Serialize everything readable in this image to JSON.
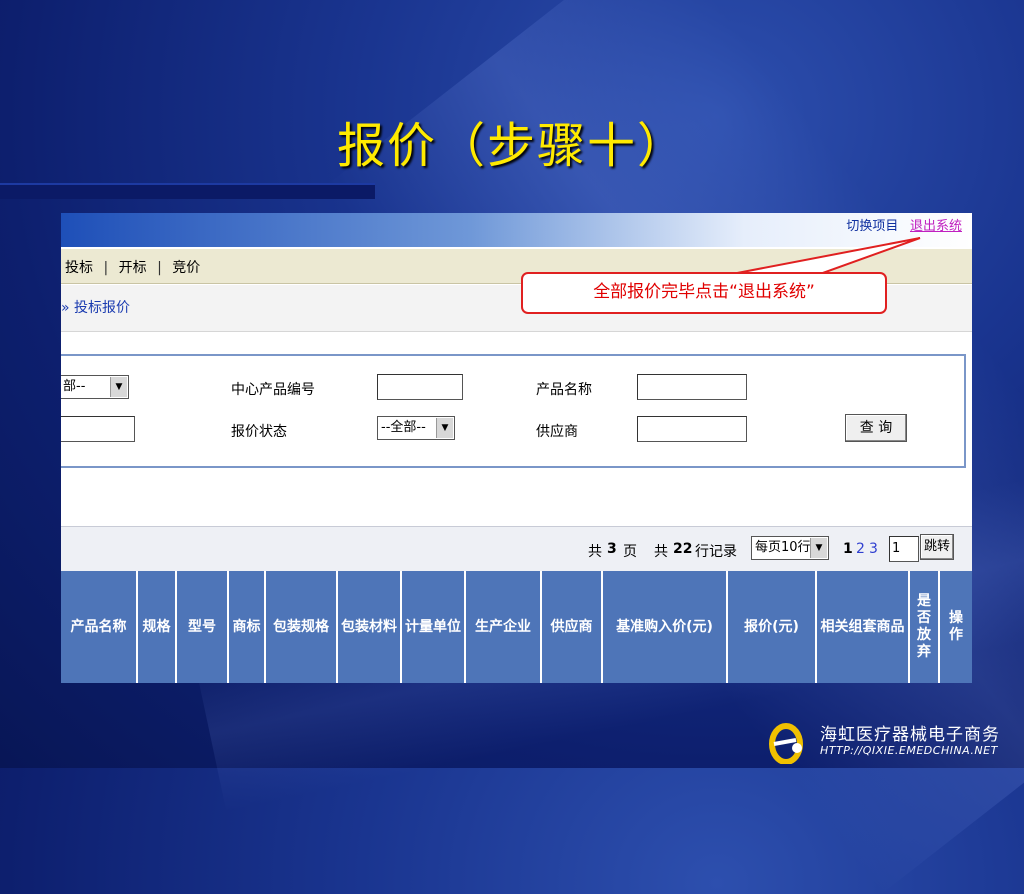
{
  "slide": {
    "title": "报价（步骤十）"
  },
  "top_links": {
    "switch_project": "切换项目",
    "logout": "退出系统"
  },
  "nav": {
    "items": [
      "投标",
      "开标",
      "竞价"
    ],
    "separator": "|"
  },
  "breadcrumb": {
    "text": "» 投标报价"
  },
  "search": {
    "category_select": "部--",
    "center_code_label": "中心产品编号",
    "product_name_label": "产品名称",
    "quote_status_label": "报价状态",
    "quote_status_select": "--全部--",
    "supplier_label": "供应商",
    "query_button": "查 询"
  },
  "pager": {
    "total_pages_prefix": "共",
    "total_pages": "3",
    "total_pages_suffix": "页",
    "total_rows_prefix": "共",
    "total_rows": "22",
    "total_rows_suffix": "行记录",
    "per_page_select": "每页10行",
    "page1": "1",
    "page2": "2",
    "page3": "3",
    "page_input": "1",
    "jump_button": "跳转"
  },
  "table": {
    "columns": [
      "产品名称",
      "规格",
      "型号",
      "商标",
      "包装规格",
      "包装材料",
      "计量单位",
      "生产企业",
      "供应商",
      "基准购入价(元)",
      "报价(元)",
      "相关组套商品",
      "是否放弃",
      "操作"
    ]
  },
  "callout": {
    "text": "全部报价完毕点击“退出系统”"
  },
  "logo": {
    "company": "海虹医疗器械电子商务",
    "url": "HTTP://QIXIE.EMEDCHINA.NET"
  },
  "colors": {
    "title": "#ffea00",
    "callout": "#e00000",
    "table_header": "#4e75b8"
  }
}
